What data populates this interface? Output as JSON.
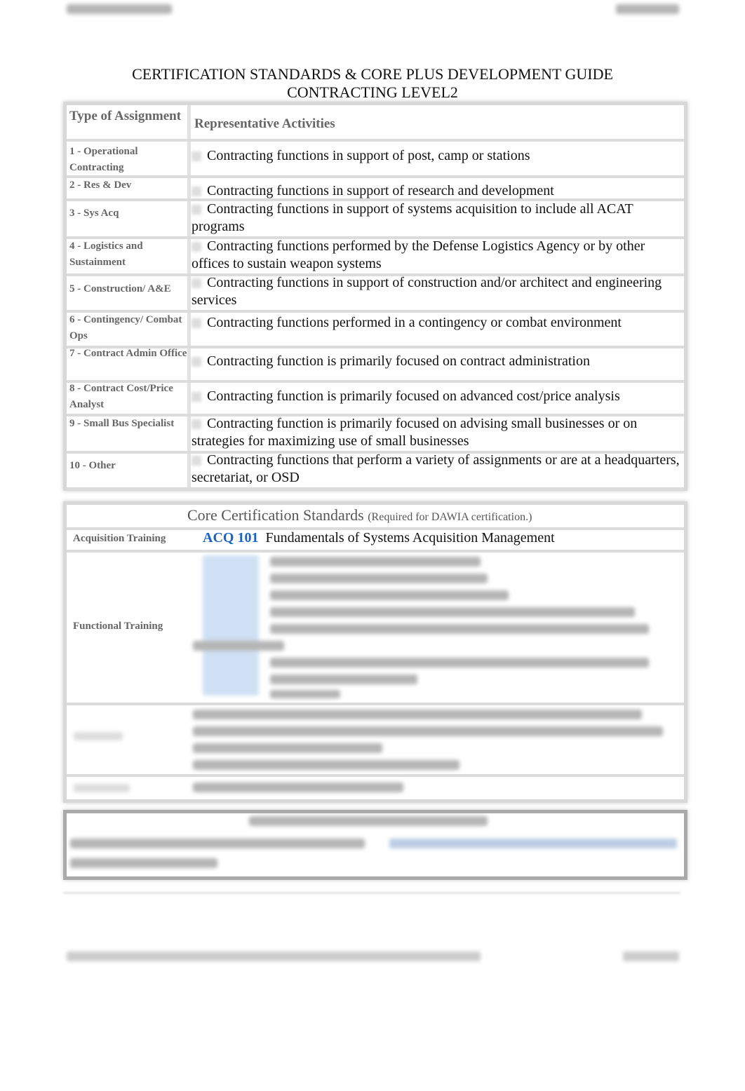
{
  "document": {
    "title_line1": "CERTIFICATION STANDARDS & CORE PLUS DEVELOPMENT GUIDE",
    "title_line2": "CONTRACTING  LEVEL2"
  },
  "assignments_table": {
    "header": {
      "type": "Type of Assignment",
      "activities": "Representative Activities"
    },
    "rows": [
      {
        "type": "1 - Operational Contracting",
        "activity": "Contracting functions in support of post, camp or stations"
      },
      {
        "type": "2 - Res & Dev",
        "activity": "Contracting functions in support of research and development"
      },
      {
        "type": "3 - Sys Acq",
        "activity": "Contracting functions in support of systems acquisition to include all ACAT programs"
      },
      {
        "type": "4 - Logistics and Sustainment",
        "activity": "Contracting functions performed by the Defense Logistics Agency or by other offices to sustain weapon systems"
      },
      {
        "type": "5 - Construction/ A&E",
        "activity": "Contracting functions in support of construction and/or architect and engineering services"
      },
      {
        "type": "6 - Contingency/ Combat Ops",
        "activity": "Contracting functions performed in a contingency or combat environment"
      },
      {
        "type": "7 - Contract Admin Office",
        "activity": "Contracting function is primarily focused on contract administration"
      },
      {
        "type": "8 - Contract Cost/Price Analyst",
        "activity": "Contracting function is primarily focused on advanced cost/price analysis"
      },
      {
        "type": "9 - Small Bus Specialist",
        "activity": "Contracting function is primarily focused on advising small businesses or on strategies for maximizing use of small businesses"
      },
      {
        "type": "10 - Other",
        "activity": "Contracting functions that perform a variety of assignments or are at a headquarters, secretariat, or OSD"
      }
    ]
  },
  "core_table": {
    "title": "Core Certification Standards",
    "subtitle": "(Required for DAWIA certification.)",
    "acquisition_label": "Acquisition Training",
    "acq_code": "ACQ 101",
    "acq_title": "Fundamentals of Systems Acquisition Management",
    "functional_label": "Functional Training",
    "accent_color": "#1a63c4"
  }
}
